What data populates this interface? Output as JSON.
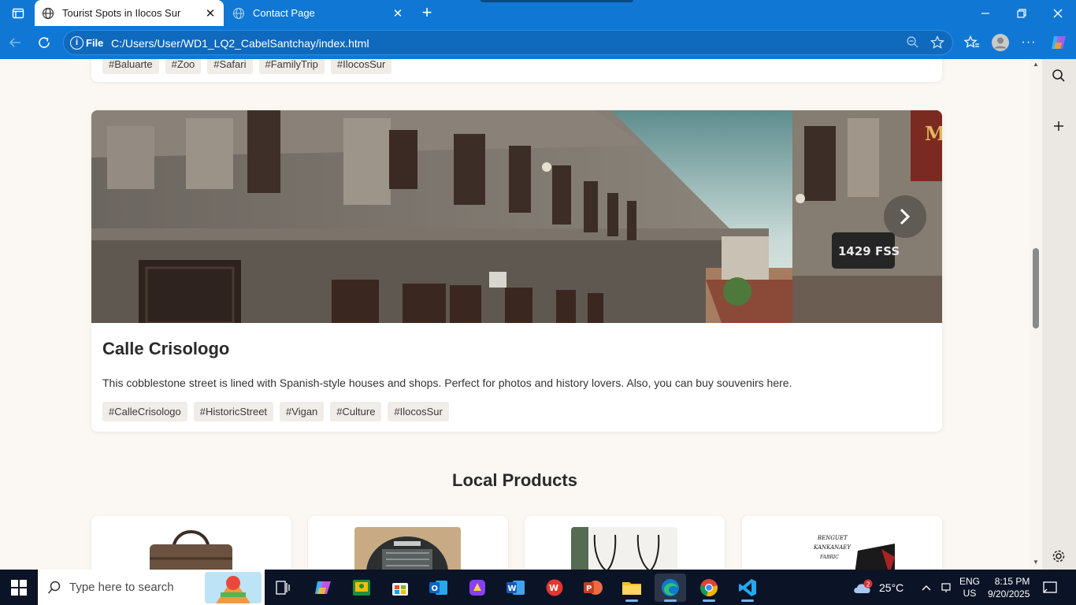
{
  "browser": {
    "tabs": [
      {
        "label": "Tourist Spots in Ilocos Sur",
        "active": true
      },
      {
        "label": "Contact Page",
        "active": false
      }
    ],
    "address": {
      "scheme_label": "File",
      "url": "C:/Users/User/WD1_LQ2_CabelSantchay/index.html"
    }
  },
  "page": {
    "card_prev": {
      "tags": [
        "#Baluarte",
        "#Zoo",
        "#Safari",
        "#FamilyTrip",
        "#IlocosSur"
      ]
    },
    "card_current": {
      "title": "Calle Crisologo",
      "description": "This cobblestone street is lined with Spanish-style houses and shops. Perfect for photos and history lovers. Also, you can buy souvenirs here.",
      "tags": [
        "#CalleCrisologo",
        "#HistoricStreet",
        "#Vigan",
        "#Culture",
        "#IlocosSur"
      ],
      "photo_sign_1": "1429 FSS",
      "photo_sign_2": "M"
    },
    "section": {
      "title": "Local Products"
    },
    "products": [
      {
        "name": "woven-bag"
      },
      {
        "name": "woven-backpack"
      },
      {
        "name": "beaded-necklace"
      },
      {
        "name": "benguet-kankanaey-fabric",
        "label_line1": "BENGUET",
        "label_line2": "KANKANAEY",
        "label_line3": "FABRIC"
      }
    ]
  },
  "taskbar": {
    "search_placeholder": "Type here to search",
    "weather": {
      "temp": "25°C",
      "badge": "2"
    },
    "language": {
      "line1": "ENG",
      "line2": "US"
    },
    "time": "8:15 PM",
    "date": "9/20/2025"
  }
}
